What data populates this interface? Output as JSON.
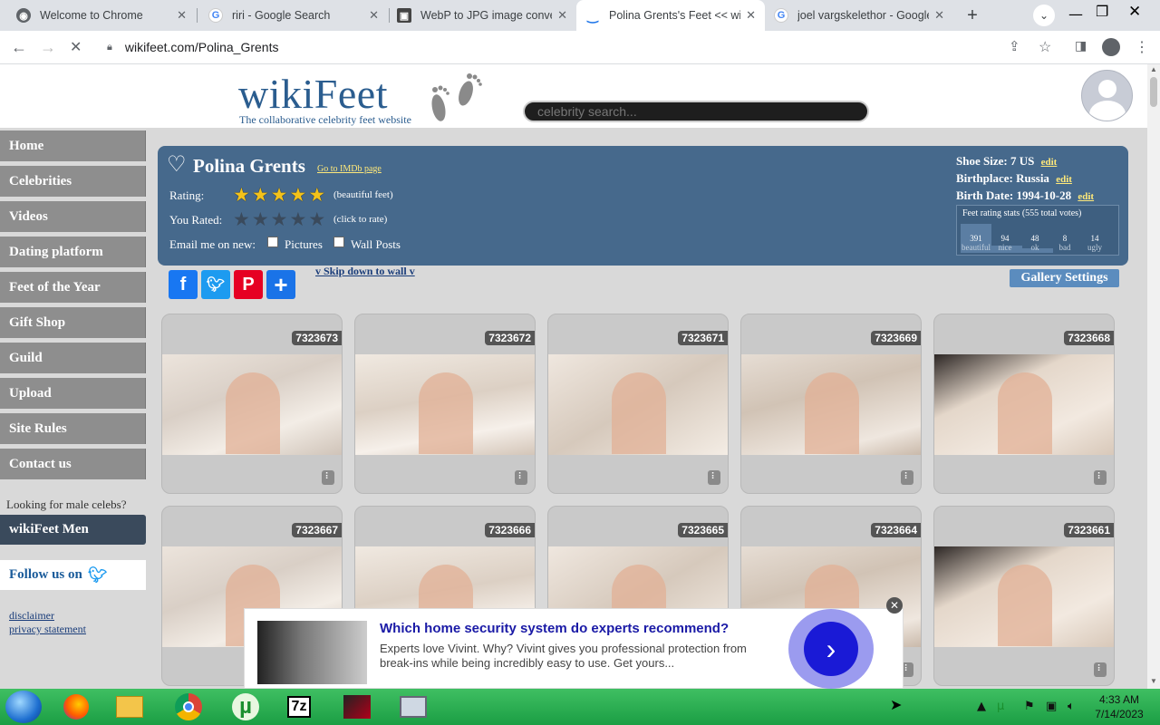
{
  "browser": {
    "tabs": [
      {
        "title": "Welcome to Chrome",
        "icon": "chrome-icon"
      },
      {
        "title": "riri - Google Search",
        "icon": "google-icon"
      },
      {
        "title": "WebP to JPG image conver",
        "icon": "image-converter-icon"
      },
      {
        "title": "Polina Grents's Feet << wi",
        "icon": "wikifeet-icon"
      },
      {
        "title": "joel vargskelethor - Google",
        "icon": "google-icon"
      }
    ],
    "active_tab": 3,
    "url": "wikifeet.com/Polina_Grents"
  },
  "site": {
    "logo": "wikiFeet",
    "tagline": "The collaborative celebrity feet website",
    "search_placeholder": "celebrity search..."
  },
  "sidebar": {
    "items": [
      "Home",
      "Celebrities",
      "Videos",
      "Dating platform",
      "Feet of the Year",
      "Gift Shop",
      "Guild",
      "Upload",
      "Site Rules",
      "Contact us"
    ],
    "male_prompt": "Looking for male celebs?",
    "men_button": "wikiFeet Men",
    "follow": "Follow us on",
    "disclaimer": "disclaimer",
    "privacy": "privacy statement"
  },
  "profile": {
    "name": "Polina Grents",
    "imdb_link": "Go to IMDb page",
    "rating_label": "Rating:",
    "rating_stars": 5,
    "rating_note": "(beautiful feet)",
    "you_rated_label": "You Rated:",
    "you_rated_stars": 0,
    "you_rated_note": "(click to rate)",
    "email_label": "Email me on new:",
    "email_options": [
      "Pictures",
      "Wall Posts"
    ],
    "shoe_size_label": "Shoe Size:",
    "shoe_size": "7 US",
    "birthplace_label": "Birthplace:",
    "birthplace": "Russia",
    "birth_date_label": "Birth Date:",
    "birth_date": "1994-10-28",
    "edit_label": "edit",
    "stats_title": "Feet rating stats (555 total votes)",
    "stats": [
      {
        "count": "391",
        "label": "beautiful"
      },
      {
        "count": "94",
        "label": "nice"
      },
      {
        "count": "48",
        "label": "ok"
      },
      {
        "count": "8",
        "label": "bad"
      },
      {
        "count": "14",
        "label": "ugly"
      }
    ]
  },
  "actions": {
    "skip_link": "v Skip down to wall v",
    "gallery_settings": "Gallery Settings",
    "social": [
      "facebook-icon",
      "twitter-icon",
      "pinterest-icon",
      "share-icon"
    ]
  },
  "photos": [
    "7323673",
    "7323672",
    "7323671",
    "7323669",
    "7323668",
    "7323667",
    "7323666",
    "7323665",
    "7323664",
    "7323661"
  ],
  "ad": {
    "title": "Which home security system do experts recommend?",
    "body": "Experts love Vivint. Why? Vivint gives you professional protection from break-ins while being incredibly easy to use. Get yours..."
  },
  "taskbar": {
    "time": "4:33 AM",
    "date": "7/14/2023",
    "apps": [
      "start-orb-icon",
      "firefox-icon",
      "file-explorer-icon",
      "chrome-icon",
      "utorrent-icon",
      "7zip-icon",
      "game-icon",
      "monitor-icon"
    ],
    "app_labels": {
      "sevenzip": "7z"
    }
  },
  "colors": {
    "profile_bg": "#46698c",
    "sidebar_bg": "#8e8e8e",
    "taskbar": "#2aae52",
    "ad_cta": "#1a1ad6"
  }
}
